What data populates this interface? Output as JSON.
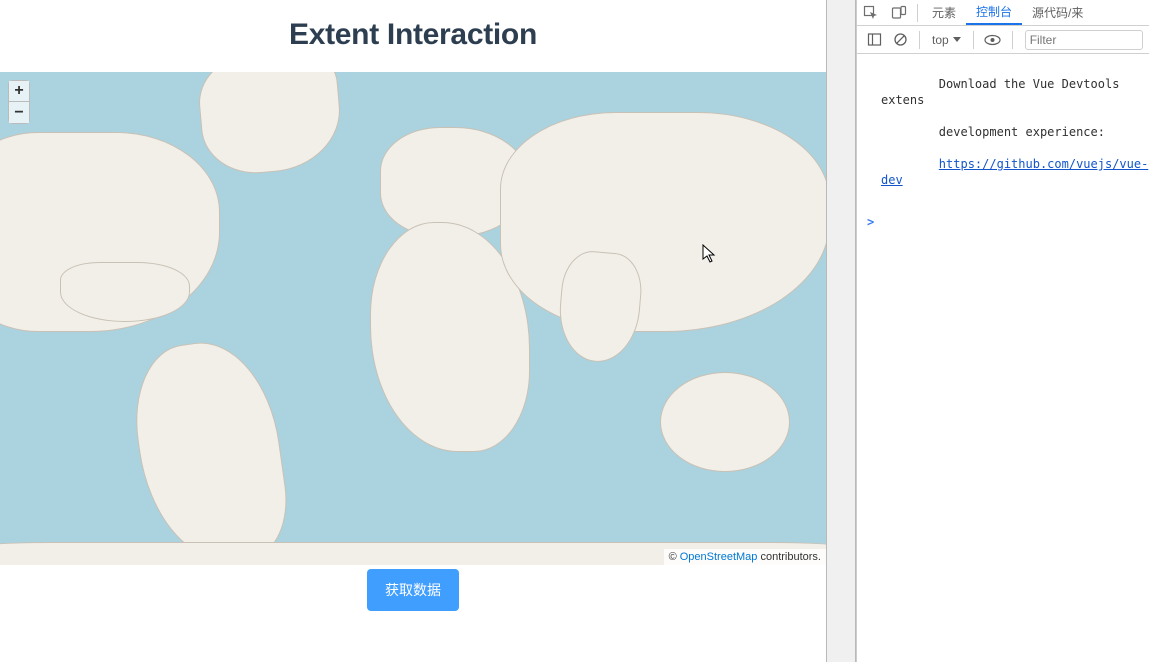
{
  "title": "Extent Interaction",
  "zoom": {
    "in": "+",
    "out": "−"
  },
  "attribution": {
    "prefix": "© ",
    "link_text": "OpenStreetMap",
    "suffix": " contributors."
  },
  "button": {
    "get_data": "获取数据"
  },
  "devtools": {
    "tabs": {
      "elements": "元素",
      "console": "控制台",
      "sources": "源代码/来"
    },
    "toolbar": {
      "context": "top",
      "filter_placeholder": "Filter"
    },
    "console": {
      "msg_line1": "Download the Vue Devtools extens",
      "msg_line2": "development experience:",
      "msg_link": "https://github.com/vuejs/vue-dev",
      "prompt": ">"
    }
  }
}
